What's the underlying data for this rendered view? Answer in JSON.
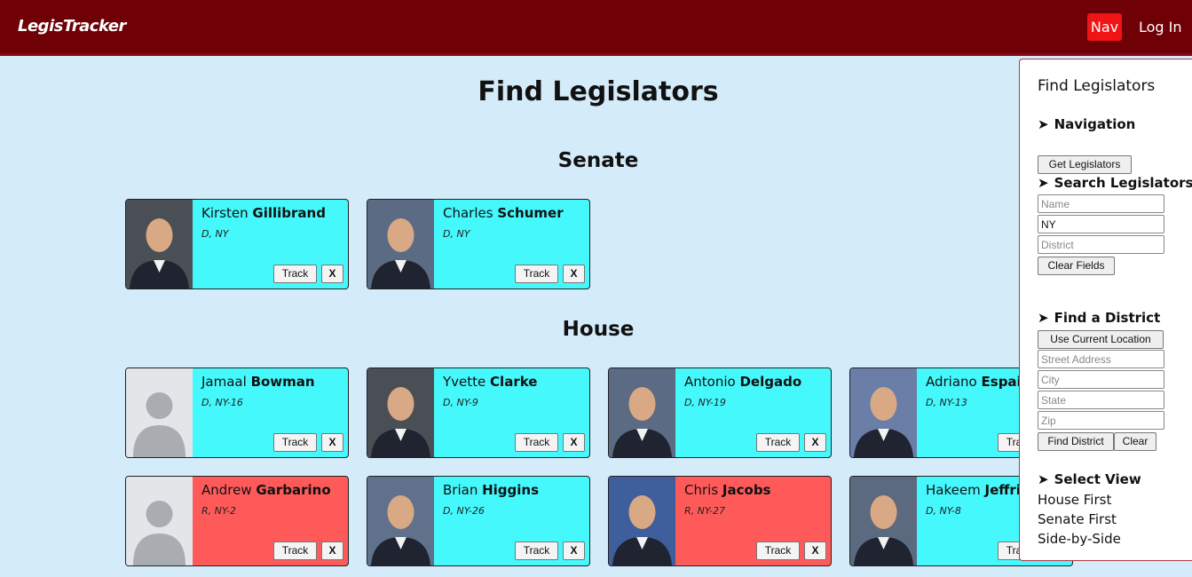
{
  "header": {
    "brand": "LegisTracker",
    "nav_label": "Nav",
    "login_label": "Log In"
  },
  "page": {
    "title": "Find Legislators"
  },
  "sections": {
    "senate": "Senate",
    "house": "House"
  },
  "buttons": {
    "track": "Track",
    "remove": "X"
  },
  "senate": [
    {
      "first": "Kirsten",
      "last": "Gillibrand",
      "party": "D, NY",
      "party_code": "D"
    },
    {
      "first": "Charles",
      "last": "Schumer",
      "party": "D, NY",
      "party_code": "D"
    }
  ],
  "house": [
    {
      "first": "Jamaal",
      "last": "Bowman",
      "party": "D, NY-16",
      "party_code": "D",
      "photo": "placeholder"
    },
    {
      "first": "Yvette",
      "last": "Clarke",
      "party": "D, NY-9",
      "party_code": "D"
    },
    {
      "first": "Antonio",
      "last": "Delgado",
      "party": "D, NY-19",
      "party_code": "D"
    },
    {
      "first": "Adriano",
      "last": "Espaillat",
      "party": "D, NY-13",
      "party_code": "D"
    },
    {
      "first": "Andrew",
      "last": "Garbarino",
      "party": "R, NY-2",
      "party_code": "R",
      "photo": "placeholder"
    },
    {
      "first": "Brian",
      "last": "Higgins",
      "party": "D, NY-26",
      "party_code": "D"
    },
    {
      "first": "Chris",
      "last": "Jacobs",
      "party": "R, NY-27",
      "party_code": "R"
    },
    {
      "first": "Hakeem",
      "last": "Jeffries",
      "party": "D, NY-8",
      "party_code": "D"
    }
  ],
  "sidebar": {
    "title": "Find Legislators",
    "arrow": "➤",
    "navigation": {
      "heading": "Navigation",
      "get_button": "Get Legislators"
    },
    "search": {
      "heading": "Search Legislators",
      "name_placeholder": "Name",
      "state_value": "NY",
      "district_placeholder": "District",
      "clear_button": "Clear Fields"
    },
    "district": {
      "heading": "Find a District",
      "location_button": "Use Current Location",
      "street_placeholder": "Street Address",
      "city_placeholder": "City",
      "state_placeholder": "State",
      "zip_placeholder": "Zip",
      "find_button": "Find District",
      "clear_button": "Clear"
    },
    "view": {
      "heading": "Select View",
      "options": [
        "House First",
        "Senate First",
        "Side-by-Side"
      ]
    }
  },
  "colors": {
    "header": "#6e0006",
    "background": "#d4ebfa",
    "democrat": "#44f8fc",
    "republican": "#ff5a5a",
    "nav_button": "#f01414"
  }
}
